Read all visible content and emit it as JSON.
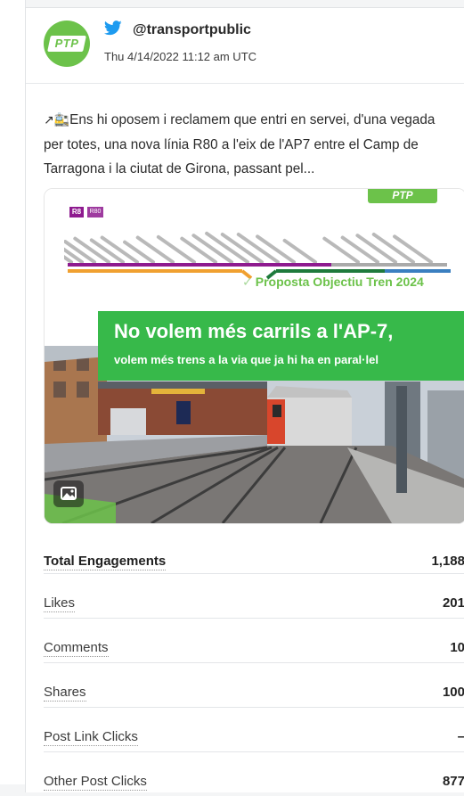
{
  "post": {
    "handle": "@transportpublic",
    "timestamp": "Thu 4/14/2022 11:12 am UTC",
    "avatar_text": "PTP",
    "text_emoji": "↗🚉",
    "text": "Ens hi oposem i reclamem que entri en servei, d'una vegada per totes, una nova línia R80 a l'eix de l'AP7 entre el Camp de Tarragona i la ciutat de Girona, passant pel..."
  },
  "media": {
    "badge_r8": "R8",
    "badge_r80": "R80",
    "ptp_tag": "PTP",
    "proposal": "Proposta Objectiu Tren 2024",
    "banner_title": "No volem més carrils a l'AP-7,",
    "banner_sub": "volem més trens a la via que ja hi ha en paral·lel"
  },
  "metrics": [
    {
      "label": "Total Engagements",
      "value": "1,188"
    },
    {
      "label": "Likes",
      "value": "201"
    },
    {
      "label": "Comments",
      "value": "10"
    },
    {
      "label": "Shares",
      "value": "100"
    },
    {
      "label": "Post Link Clicks",
      "value": "–"
    },
    {
      "label": "Other Post Clicks",
      "value": "877"
    }
  ],
  "colors": {
    "brand_green": "#6cc24a",
    "banner_green": "#37b94a",
    "r8_purple": "#8e1a8f",
    "twitter_blue": "#1d9bf0"
  }
}
